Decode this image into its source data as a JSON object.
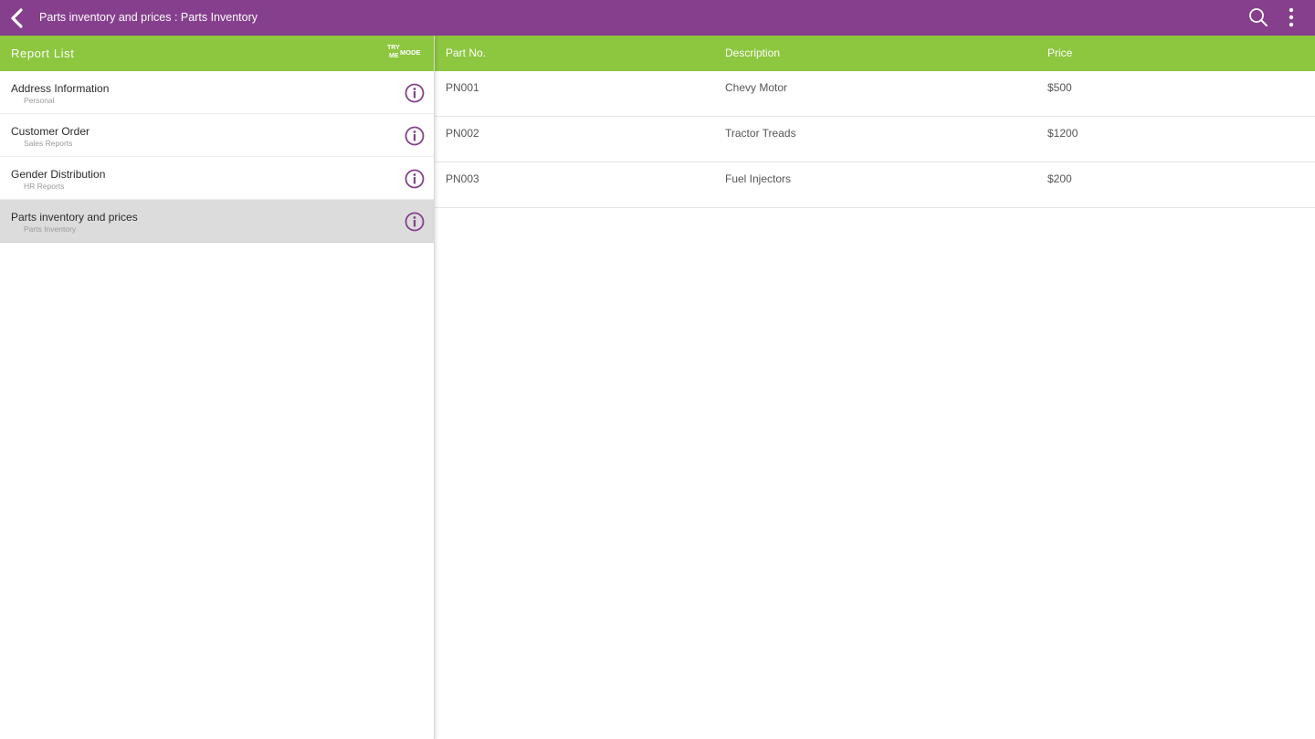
{
  "app": {
    "title": "Parts inventory and prices : Parts Inventory",
    "colors": {
      "primary": "#853f8d",
      "accent": "#8dc63f"
    },
    "icons": {
      "back": "chevron-left-icon",
      "search": "search-icon",
      "menu": "more-vert-icon",
      "info": "info-icon"
    }
  },
  "sidebar": {
    "title": "Report List",
    "try_me": {
      "line1": "TRY",
      "line2": "ME",
      "line3": "MODE"
    },
    "items": [
      {
        "name": "Address Information",
        "category": "Personal"
      },
      {
        "name": "Customer Order",
        "category": "Sales Reports"
      },
      {
        "name": "Gender Distribution",
        "category": "HR Reports"
      },
      {
        "name": "Parts inventory and prices",
        "category": "Parts Inventory",
        "selected": true
      }
    ]
  },
  "table": {
    "columns": [
      "Part No.",
      "Description",
      "Price"
    ],
    "rows": [
      [
        "PN001",
        "Chevy Motor",
        "$500"
      ],
      [
        "PN002",
        "Tractor Treads",
        "$1200"
      ],
      [
        "PN003",
        "Fuel Injectors",
        "$200"
      ]
    ]
  }
}
